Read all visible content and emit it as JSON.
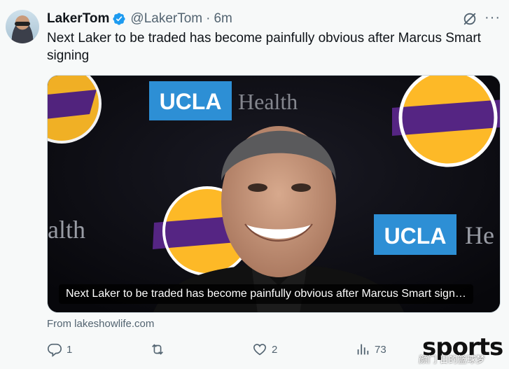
{
  "author": {
    "name": "LakerTom",
    "handle": "@LakerTom",
    "separator": "·",
    "time": "6m",
    "avatar_icon": "avatar-photo"
  },
  "tweet": {
    "text": "Next Laker to be traded has become painfully obvious after Marcus Smart signing"
  },
  "card": {
    "caption": "Next Laker to be traded has become painfully obvious after Marcus Smart sign…",
    "background_text": [
      "UCLA",
      "Health",
      "alth",
      "UCLA",
      "He"
    ],
    "source": "From lakeshowlife.com"
  },
  "actions": {
    "replies": "1",
    "retweets": "",
    "likes": "2",
    "views": "73"
  },
  "watermark": {
    "brand": "sports",
    "sub": "颜门 日的篮球梦"
  },
  "colors": {
    "accent": "#1d9bf0",
    "text_secondary": "#536471",
    "ucla_blue": "#2d8fd5",
    "lakers_gold": "#fdb927",
    "lakers_purple": "#552583"
  }
}
